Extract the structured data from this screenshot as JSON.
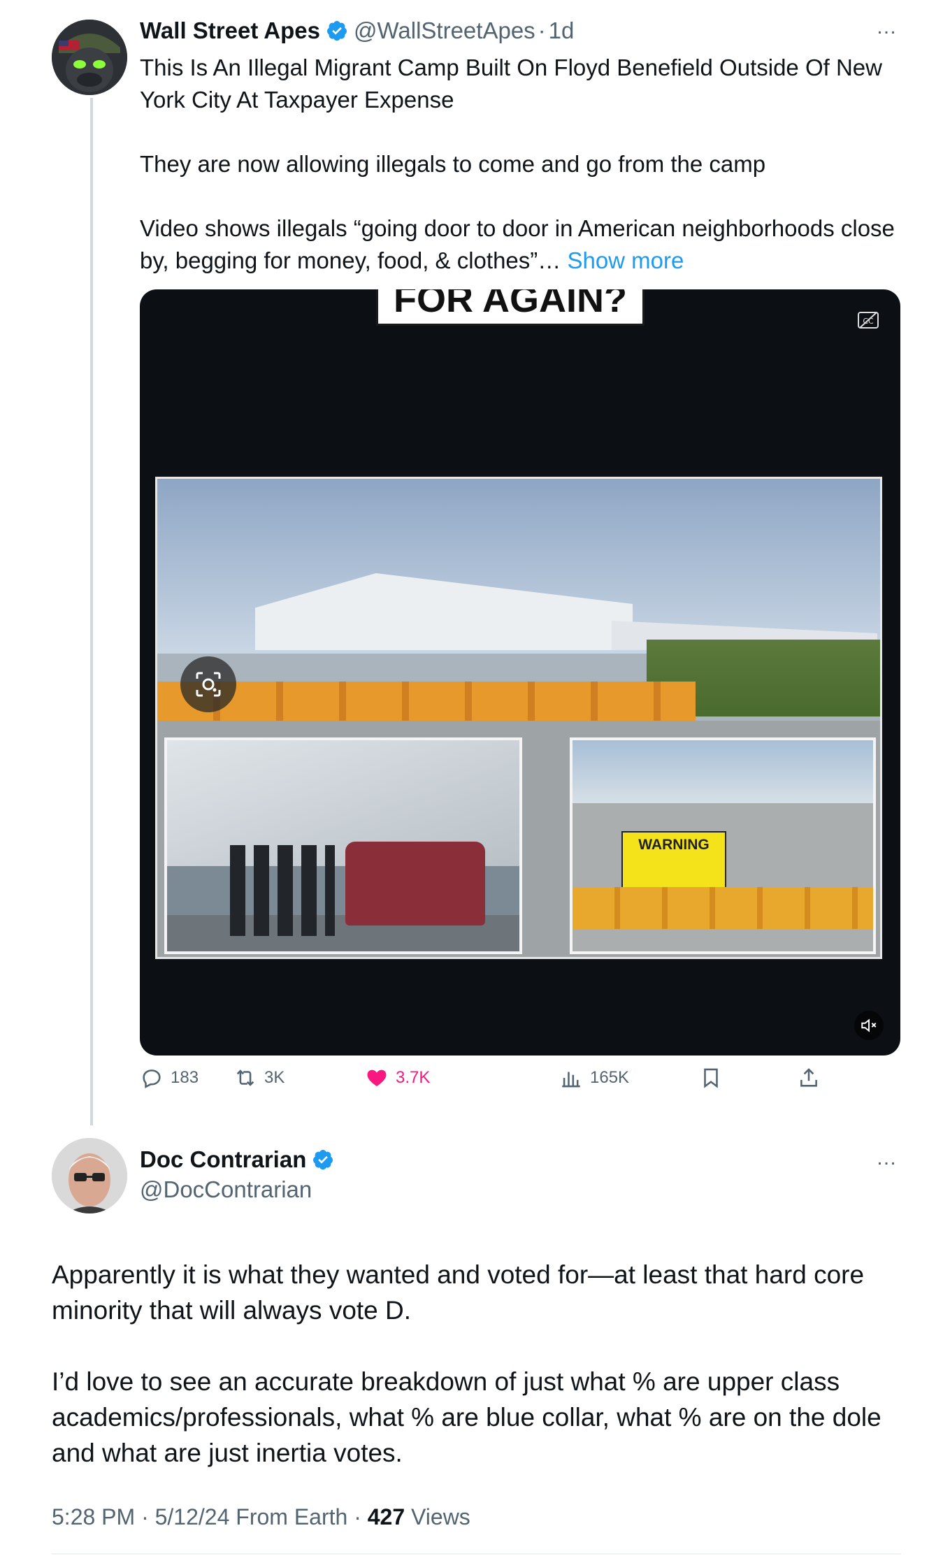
{
  "original_tweet": {
    "author": {
      "name": "Wall Street Apes",
      "handle": "@WallStreetApes",
      "age": "1d"
    },
    "more_label": "…",
    "paragraphs": [
      "This Is An Illegal Migrant Camp Built On Floyd Benefield Outside Of New York City At Taxpayer Expense",
      "They are now allowing illegals to come and go from the camp",
      "Video shows illegals “going door to door in American neighborhoods close by, begging for money, food, & clothes”…"
    ],
    "show_more": "Show more",
    "media": {
      "caption": "FOR AGAIN?",
      "warning_sign": "WARNING"
    },
    "stats": {
      "replies": "183",
      "reposts": "3K",
      "likes": "3.7K",
      "views": "165K"
    }
  },
  "reply": {
    "author": {
      "name": "Doc Contrarian",
      "handle": "@DocContrarian"
    },
    "more_label": "…",
    "paragraphs": [
      "Apparently it is what they wanted and voted for—at least that hard core minority that will always vote D.",
      "I’d love to see an accurate breakdown of just what % are upper class academics/professionals, what % are blue collar, what % are on the dole and what are just inertia votes."
    ],
    "meta": {
      "time": "5:28 PM",
      "date": "5/12/24",
      "source": "From Earth",
      "views_count": "427",
      "views_label": "Views"
    }
  },
  "colors": {
    "link": "#1d9bf0",
    "verified": "#1d9bf0",
    "like": "#f91880",
    "secondary_text": "#536471"
  },
  "icons": [
    "verified-icon",
    "more-icon",
    "closed-captions-icon",
    "mute-icon",
    "lens-icon",
    "reply-icon",
    "repost-icon",
    "like-icon",
    "views-icon",
    "bookmark-icon",
    "share-icon"
  ]
}
